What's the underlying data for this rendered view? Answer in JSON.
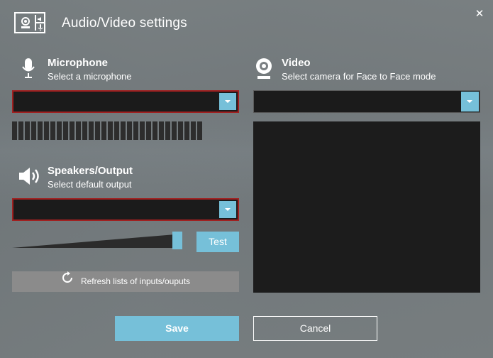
{
  "window": {
    "title": "Audio/Video settings",
    "close_symbol": "✕"
  },
  "microphone": {
    "heading": "Microphone",
    "subtitle": "Select a microphone",
    "selected": "",
    "meter_level": 0
  },
  "speakers": {
    "heading": "Speakers/Output",
    "subtitle": "Select default output",
    "selected": "",
    "volume": 1.0,
    "test_label": "Test"
  },
  "refresh": {
    "label": "Refresh lists of inputs/ouputs"
  },
  "video": {
    "heading": "Video",
    "subtitle": "Select camera for Face to Face mode",
    "selected": ""
  },
  "footer": {
    "save_label": "Save",
    "cancel_label": "Cancel"
  },
  "colors": {
    "accent": "#76c0d9",
    "error_border": "#a02020",
    "field_bg": "#1b1b1b"
  },
  "icons": [
    "app-logo-icon",
    "close-icon",
    "microphone-icon",
    "speaker-icon",
    "webcam-icon",
    "refresh-icon",
    "chevron-down-icon"
  ]
}
